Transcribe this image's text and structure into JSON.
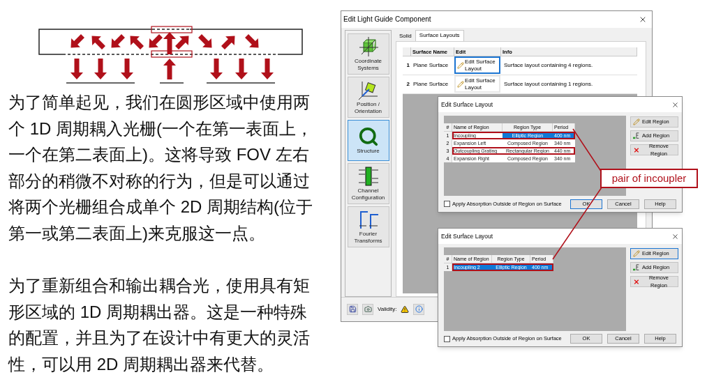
{
  "slide_text": {
    "paragraphs": [
      "为了简单起见，我们在圆形区域中使用两个 1D 周期耦入光栅(一个在第一表面上，一个在第二表面上)。这将导致 FOV 左右部分的稍微不对称的行为，但是可以通过将两个光栅组合成单个 2D 周期结构(位于第一或第二表面上)来克服这一点。",
      "为了重新组合和输出耦合光，使用具有矩形区域的 1D 周期耦出器。这是一种特殊的配置，并且为了在设计中有更大的灵活性，可以用 2D 周期耦出器来代替。"
    ]
  },
  "dialog": {
    "title": "Edit Light Guide Component",
    "sidebar": [
      {
        "label": "Coordinate Systems",
        "selected": false
      },
      {
        "label": "Position / Orientation",
        "selected": false
      },
      {
        "label": "Structure",
        "selected": true
      },
      {
        "label": "Channel Configuration",
        "selected": false
      },
      {
        "label": "Fourier Transforms",
        "selected": false
      }
    ],
    "tabs": [
      {
        "label": "Solid",
        "selected": false
      },
      {
        "label": "Surface Layouts",
        "selected": true
      }
    ],
    "table": {
      "columns": [
        "Surface Name",
        "Edit",
        "Info"
      ],
      "rows": [
        {
          "index": "1",
          "surface_name": "Plane Surface",
          "edit_button": "Edit Surface Layout",
          "focused": true,
          "info": "Surface layout containing 4 regions."
        },
        {
          "index": "2",
          "surface_name": "Plane Surface",
          "edit_button": "Edit Surface Layout",
          "focused": false,
          "info": "Surface layout containing 1 regions."
        }
      ]
    },
    "footer": {
      "validity_label": "Validity:"
    }
  },
  "sub_dialogs": [
    {
      "title": "Edit Surface Layout",
      "columns": [
        "#",
        "Name of Region",
        "Region Type",
        "Period"
      ],
      "rows": [
        {
          "highlighted": true,
          "cells": [
            {
              "text": "1",
              "selected": false
            },
            {
              "text": "Incoupling",
              "selected": false
            },
            {
              "text": "Elliptic Region",
              "selected": true
            },
            {
              "text": "400 nm",
              "selected": true
            }
          ]
        },
        {
          "highlighted": false,
          "cells": [
            {
              "text": "2",
              "selected": false
            },
            {
              "text": "Expansion Left",
              "selected": false
            },
            {
              "text": "Composed Region",
              "selected": false
            },
            {
              "text": "340 nm",
              "selected": false
            }
          ]
        },
        {
          "highlighted": true,
          "cells": [
            {
              "text": "3",
              "selected": false
            },
            {
              "text": "Outcoupling Grating",
              "selected": false
            },
            {
              "text": "Rectangular Region",
              "selected": false
            },
            {
              "text": "440 nm",
              "selected": false
            }
          ]
        },
        {
          "highlighted": false,
          "cells": [
            {
              "text": "4",
              "selected": false
            },
            {
              "text": "Expansion Right",
              "selected": false
            },
            {
              "text": "Composed Region",
              "selected": false
            },
            {
              "text": "340 nm",
              "selected": false
            }
          ]
        }
      ],
      "buttons": [
        {
          "label": "Edit Region",
          "kind": "edit",
          "focused": false
        },
        {
          "label": "Add Region",
          "kind": "add",
          "focused": false
        },
        {
          "label": "Remove Region",
          "kind": "remove",
          "focused": false
        }
      ],
      "checkbox": {
        "label": "Apply Absorption Outside of Region on Surface",
        "checked": false
      },
      "dialog_buttons": [
        {
          "label": "OK",
          "focused": true
        },
        {
          "label": "Cancel",
          "focused": false
        },
        {
          "label": "Help",
          "focused": false
        }
      ]
    },
    {
      "title": "Edit Surface Layout",
      "columns": [
        "#",
        "Name of Region",
        "Region Type",
        "Period"
      ],
      "rows": [
        {
          "highlighted": true,
          "cells": [
            {
              "text": "1",
              "selected": false
            },
            {
              "text": "Incoupling 2",
              "selected": true
            },
            {
              "text": "Elliptic Region",
              "selected": true
            },
            {
              "text": "400 nm",
              "selected": true
            }
          ]
        }
      ],
      "buttons": [
        {
          "label": "Edit Region",
          "kind": "edit",
          "focused": true
        },
        {
          "label": "Add Region",
          "kind": "add",
          "focused": false
        },
        {
          "label": "Remove Region",
          "kind": "remove",
          "focused": false
        }
      ],
      "checkbox": {
        "label": "Apply Absorption Outside of Region on Surface",
        "checked": false
      },
      "dialog_buttons": [
        {
          "label": "OK",
          "focused": false
        },
        {
          "label": "Cancel",
          "focused": false
        },
        {
          "label": "Help",
          "focused": false
        }
      ]
    }
  ],
  "callout": {
    "text": "pair of incoupler"
  }
}
